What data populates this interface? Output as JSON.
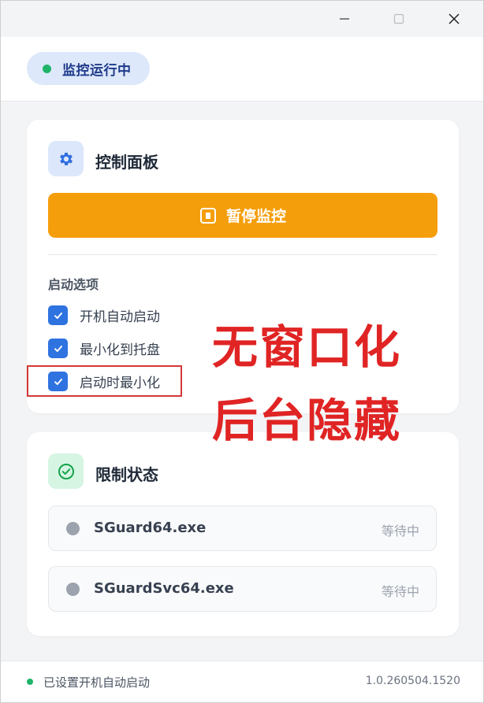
{
  "window": {
    "controls": {
      "minimize": "minimize-icon",
      "maximize": "maximize-icon",
      "close": "close-icon"
    }
  },
  "header": {
    "status_text": "监控运行中",
    "status_color": "#1fb46a"
  },
  "control_panel": {
    "title": "控制面板",
    "icon": "gear-icon",
    "pause_button_label": "暂停监控",
    "pause_button_color": "#f59e0b",
    "startup_section_label": "启动选项",
    "options": [
      {
        "label": "开机自动启动",
        "checked": true
      },
      {
        "label": "最小化到托盘",
        "checked": true
      },
      {
        "label": "启动时最小化",
        "checked": true
      }
    ]
  },
  "limit_status": {
    "title": "限制状态",
    "icon": "check-circle-icon",
    "processes": [
      {
        "name": "SGuard64.exe",
        "state": "等待中"
      },
      {
        "name": "SGuardSvc64.exe",
        "state": "等待中"
      }
    ]
  },
  "overlay": {
    "line1": "无窗口化",
    "line2": "后台隐藏",
    "color": "#e02424"
  },
  "footer": {
    "status_text": "已设置开机自动启动",
    "version": "1.0.260504.1520"
  }
}
